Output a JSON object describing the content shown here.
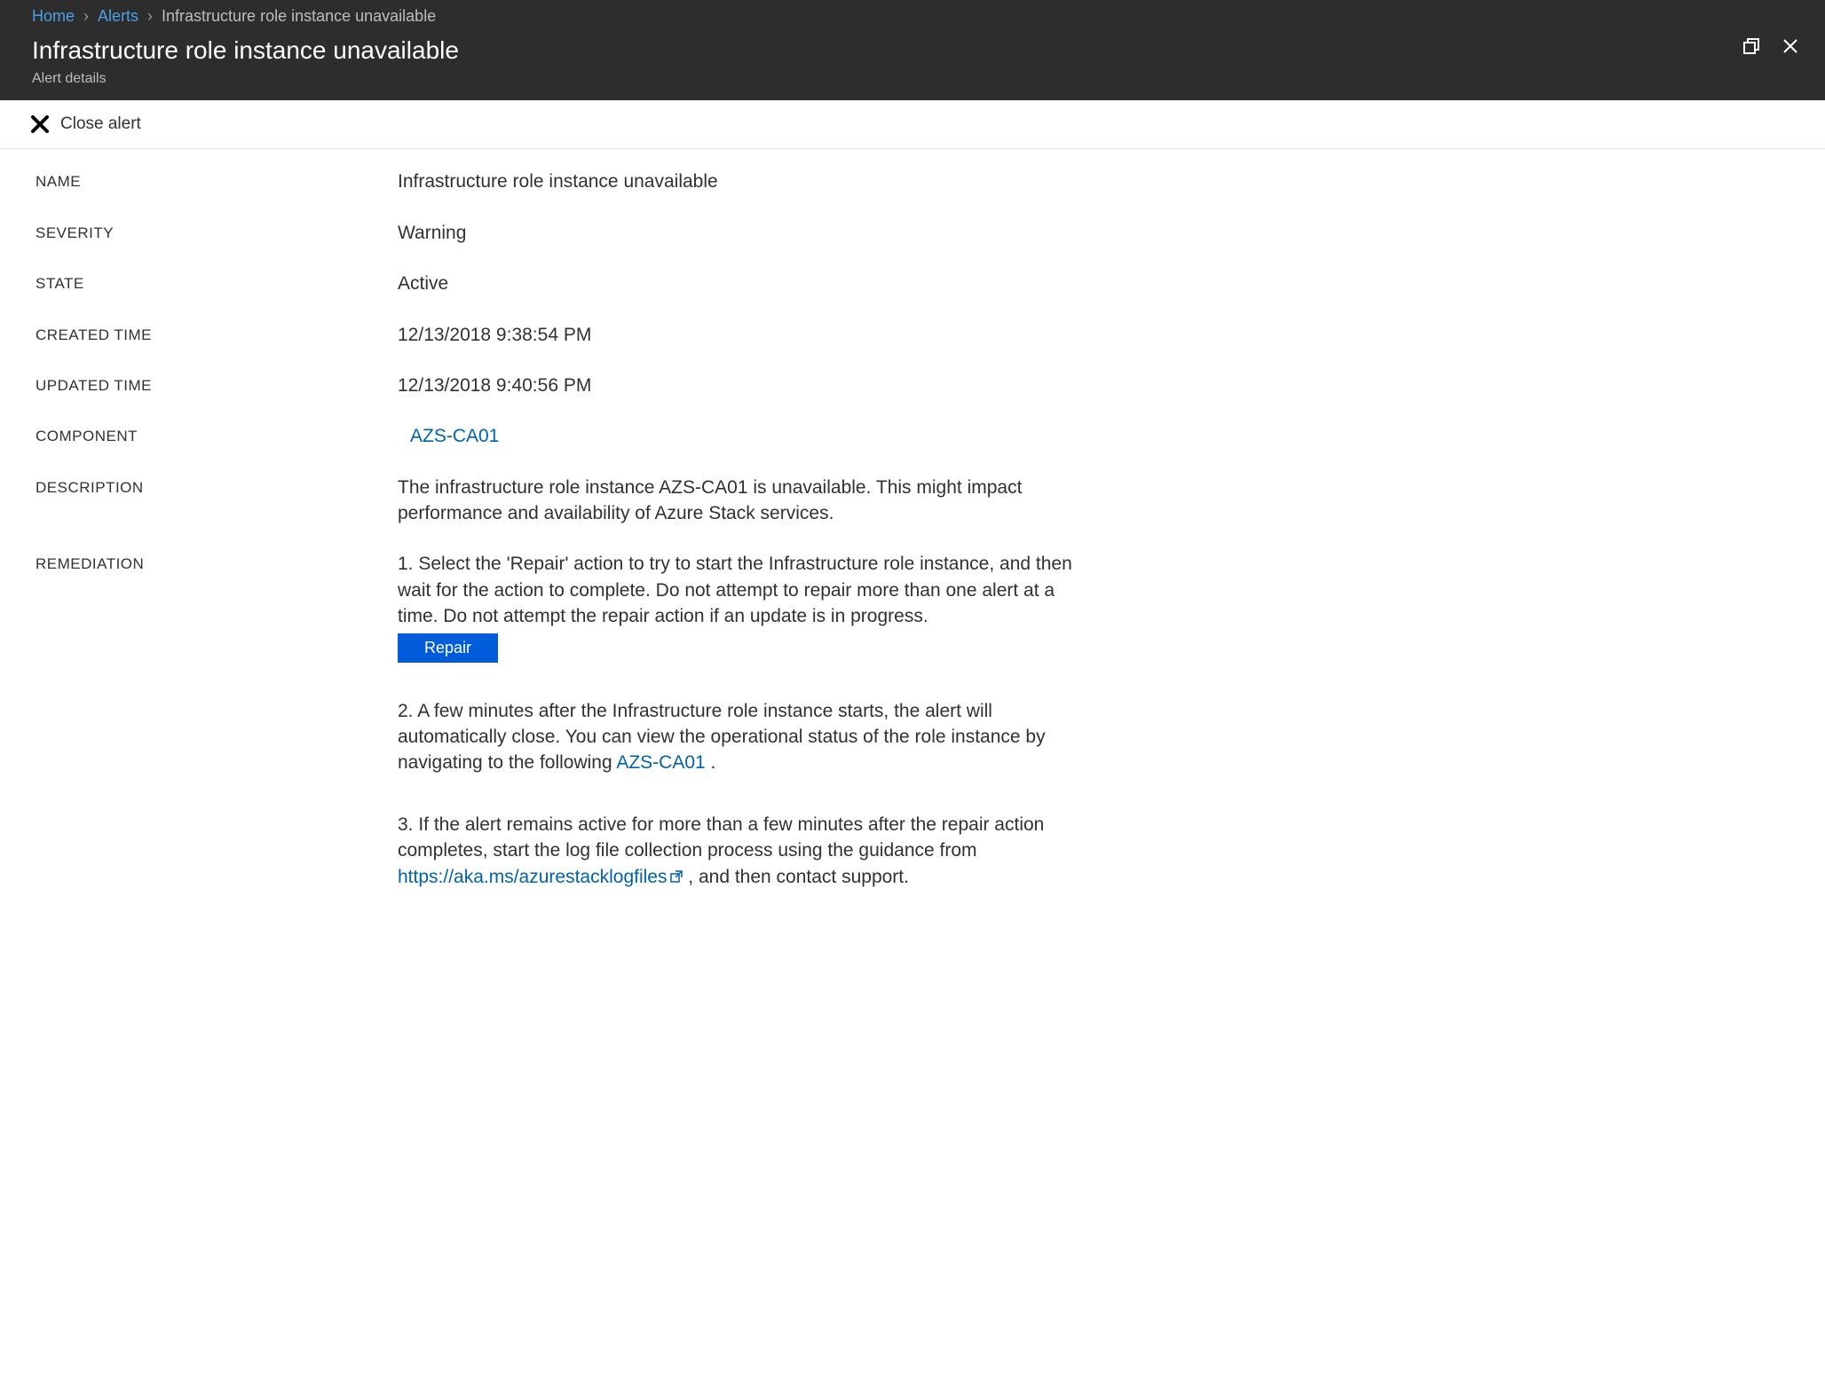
{
  "breadcrumb": {
    "home": "Home",
    "alerts": "Alerts",
    "current": "Infrastructure role instance unavailable"
  },
  "header": {
    "title": "Infrastructure role instance unavailable",
    "subtitle": "Alert details"
  },
  "toolbar": {
    "close_alert": "Close alert"
  },
  "labels": {
    "name": "NAME",
    "severity": "SEVERITY",
    "state": "STATE",
    "created_time": "CREATED TIME",
    "updated_time": "UPDATED TIME",
    "component": "COMPONENT",
    "description": "DESCRIPTION",
    "remediation": "REMEDIATION"
  },
  "values": {
    "name": "Infrastructure role instance unavailable",
    "severity": "Warning",
    "state": "Active",
    "created_time": "12/13/2018 9:38:54 PM",
    "updated_time": "12/13/2018 9:40:56 PM",
    "component": "AZS-CA01",
    "description": "The infrastructure role instance AZS-CA01 is unavailable. This might impact performance and availability of Azure Stack services."
  },
  "remediation": {
    "step1": "1. Select the 'Repair' action to try to start the Infrastructure role instance, and then wait for the action to complete. Do not attempt to repair more than one alert at a time. Do not attempt the repair action if an update is in progress.",
    "repair_label": "Repair",
    "step2_a": "2. A few minutes after the Infrastructure role instance starts, the alert will automatically close. You can view the operational status of the role instance by navigating to the following ",
    "step2_link": "AZS-CA01",
    "step2_b": " .",
    "step3_a": "3. If the alert remains active for more than a few minutes after the repair action completes, start the log file collection process using the guidance from ",
    "step3_link": "https://aka.ms/azurestacklogfiles",
    "step3_b": " , and then contact support."
  }
}
